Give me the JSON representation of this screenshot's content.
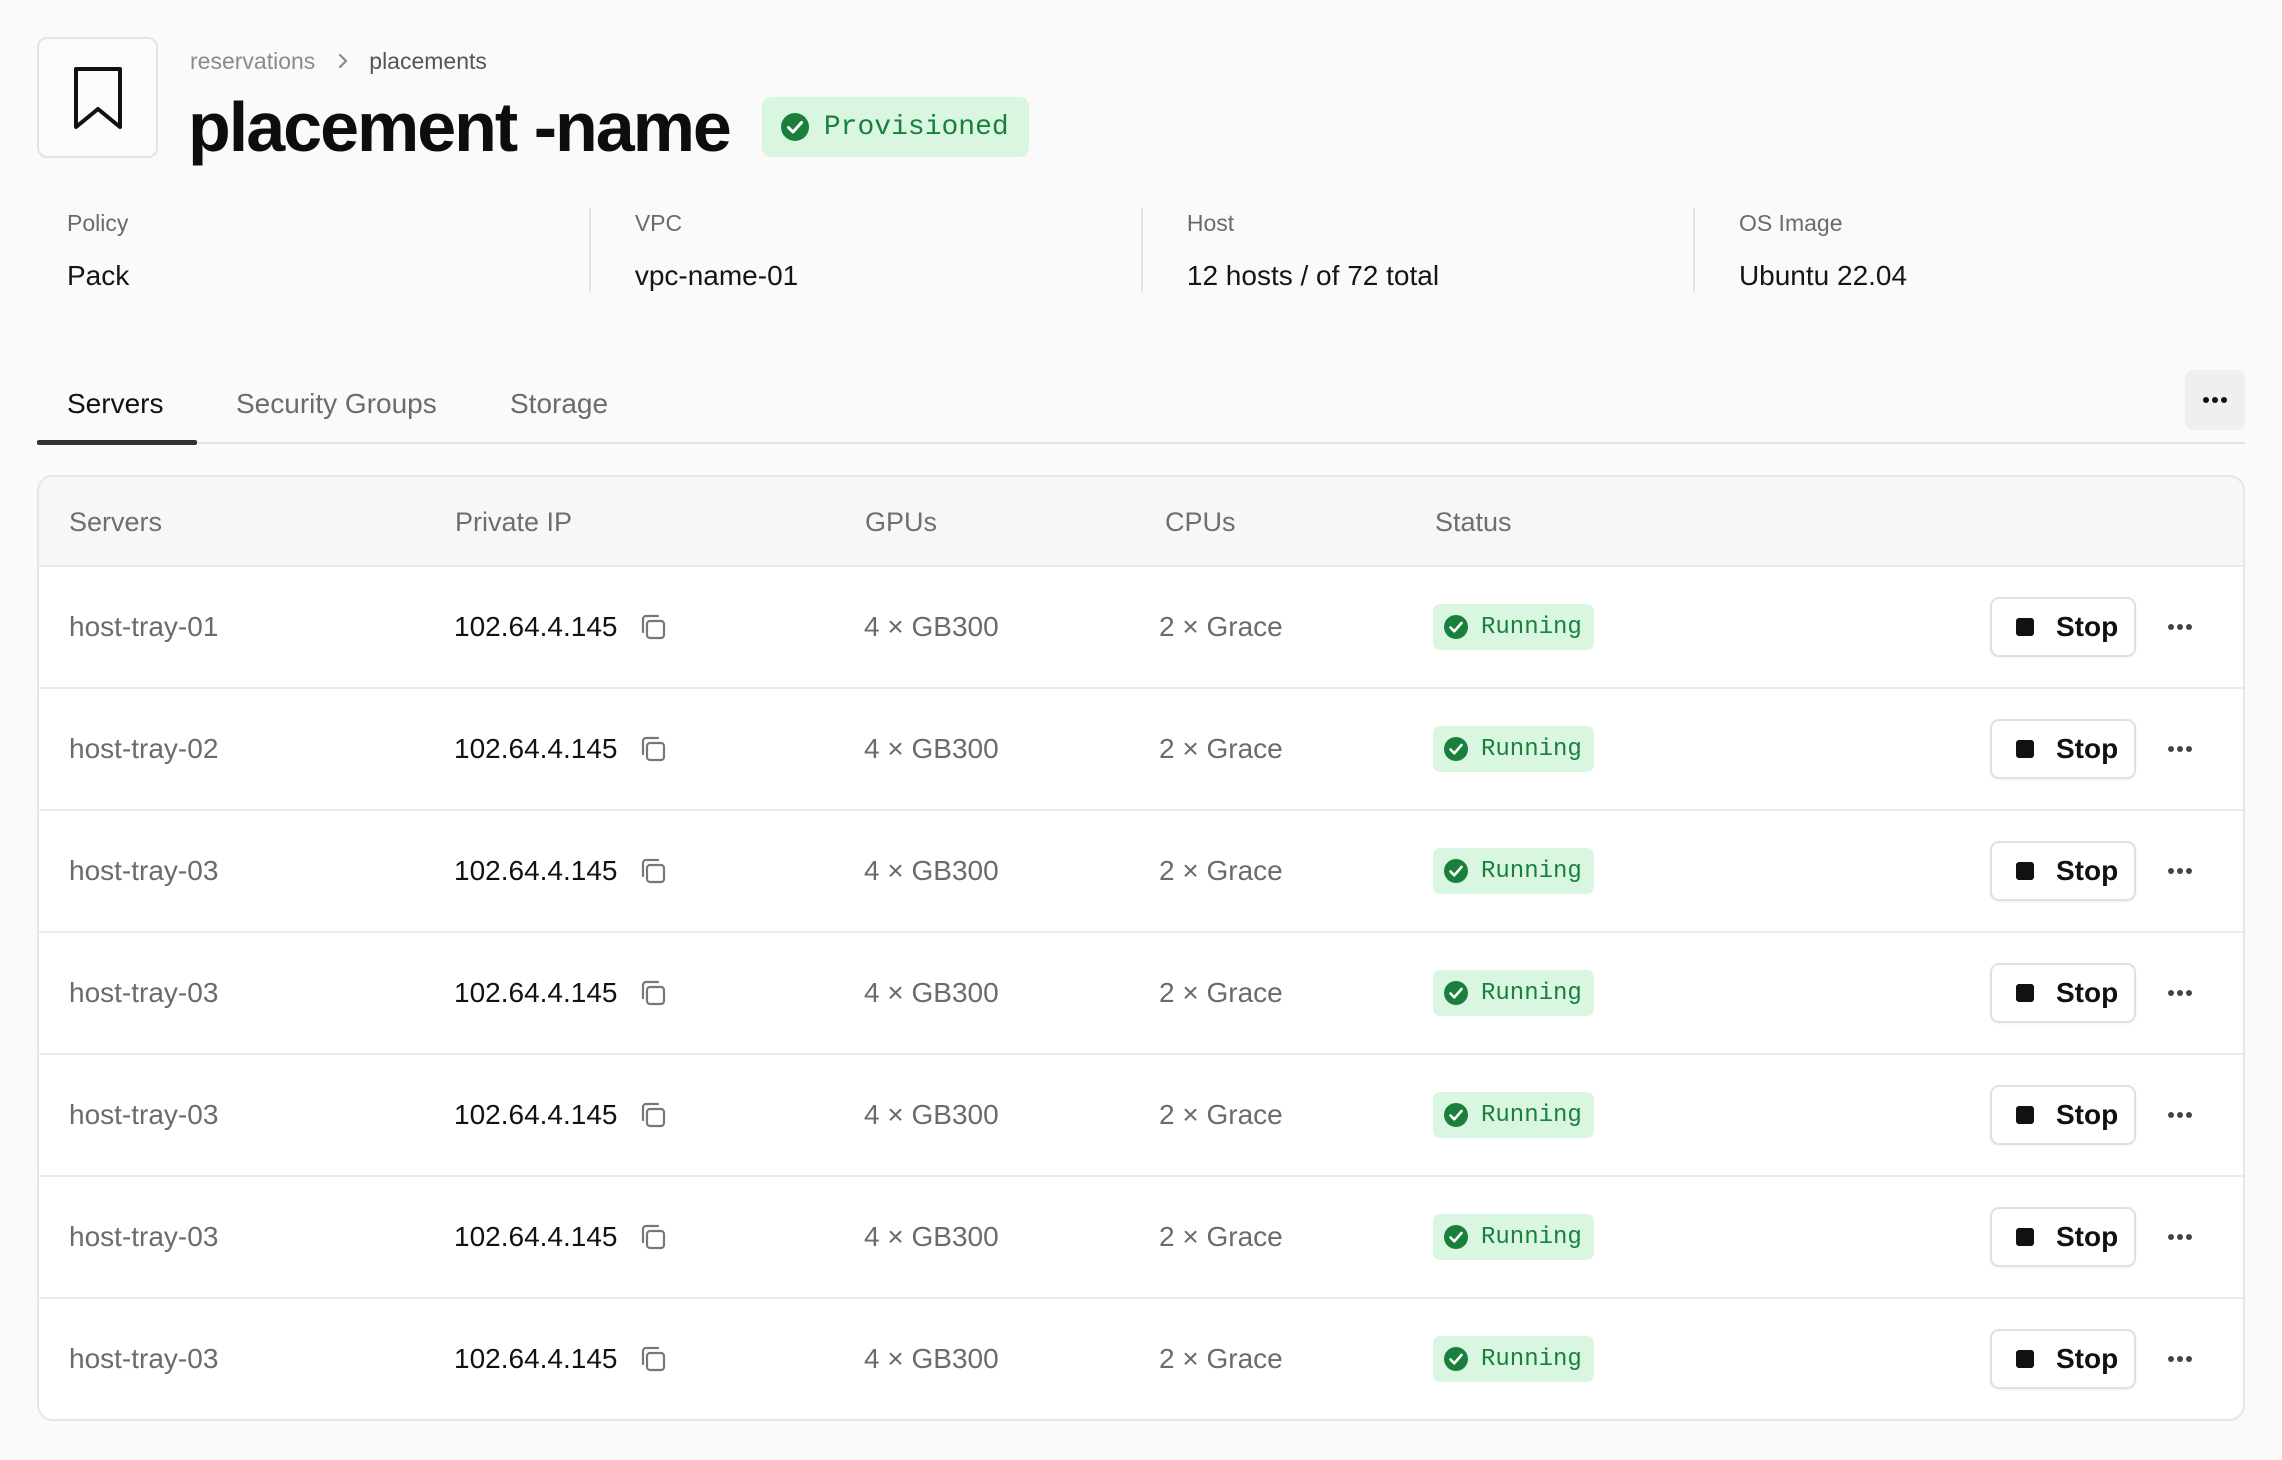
{
  "breadcrumb": {
    "parent": "reservations",
    "current": "placements"
  },
  "page": {
    "title": "placement -name",
    "status": "Provisioned"
  },
  "info": [
    {
      "label": "Policy",
      "value": "Pack"
    },
    {
      "label": "VPC",
      "value": "vpc-name-01"
    },
    {
      "label": "Host",
      "value": "12 hosts / of 72 total"
    },
    {
      "label": "OS Image",
      "value": "Ubuntu 22.04"
    }
  ],
  "tabs": [
    {
      "label": "Servers",
      "active": true
    },
    {
      "label": "Security Groups",
      "active": false
    },
    {
      "label": "Storage",
      "active": false
    }
  ],
  "table": {
    "columns": [
      "Servers",
      "Private IP",
      "GPUs",
      "CPUs",
      "Status"
    ],
    "action_label": "Stop",
    "rows": [
      {
        "server": "host-tray-01",
        "ip": "102.64.4.145",
        "gpus": "4 × GB300",
        "cpus": "2 × Grace",
        "status": "Running"
      },
      {
        "server": "host-tray-02",
        "ip": "102.64.4.145",
        "gpus": "4 × GB300",
        "cpus": "2 × Grace",
        "status": "Running"
      },
      {
        "server": "host-tray-03",
        "ip": "102.64.4.145",
        "gpus": "4 × GB300",
        "cpus": "2 × Grace",
        "status": "Running"
      },
      {
        "server": "host-tray-03",
        "ip": "102.64.4.145",
        "gpus": "4 × GB300",
        "cpus": "2 × Grace",
        "status": "Running"
      },
      {
        "server": "host-tray-03",
        "ip": "102.64.4.145",
        "gpus": "4 × GB300",
        "cpus": "2 × Grace",
        "status": "Running"
      },
      {
        "server": "host-tray-03",
        "ip": "102.64.4.145",
        "gpus": "4 × GB300",
        "cpus": "2 × Grace",
        "status": "Running"
      },
      {
        "server": "host-tray-03",
        "ip": "102.64.4.145",
        "gpus": "4 × GB300",
        "cpus": "2 × Grace",
        "status": "Running"
      }
    ]
  },
  "icons": {
    "header": "bookmark-icon",
    "breadcrumb_sep": "chevron-right-icon",
    "status": "check-circle-icon",
    "copy": "copy-icon",
    "more": "more-horizontal-icon",
    "stop": "stop-square-icon"
  },
  "colors": {
    "success_bg": "#d9f6e1",
    "success_fg": "#1a7f3c",
    "text_primary": "#111111",
    "text_muted": "#6b6b6b",
    "border": "#e3e3e3"
  }
}
